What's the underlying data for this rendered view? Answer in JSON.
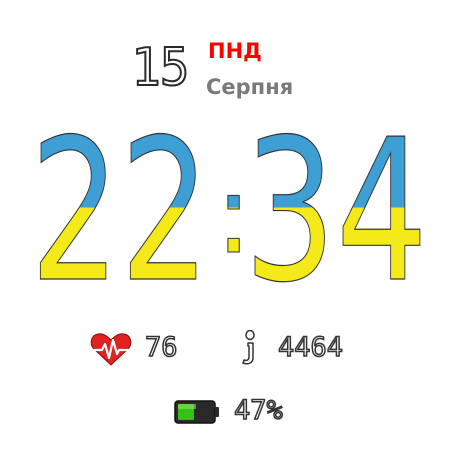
{
  "date": {
    "day": "15",
    "weekday": "ПНД",
    "month": "Серпня"
  },
  "time": {
    "hours": "22",
    "separator": ":",
    "minutes": "34"
  },
  "colors": {
    "flag_blue": "#3d9fd3",
    "flag_yellow": "#f4ea1a",
    "weekday_red": "#ff0000",
    "month_gray": "#7a7a7a",
    "battery_green": "#34c314"
  },
  "heart_rate": {
    "icon": "heart-icon",
    "value": "76"
  },
  "steps": {
    "icon": "steps-icon",
    "value": "4464"
  },
  "battery": {
    "icon": "battery-icon",
    "value": "47%",
    "level": 0.47
  }
}
